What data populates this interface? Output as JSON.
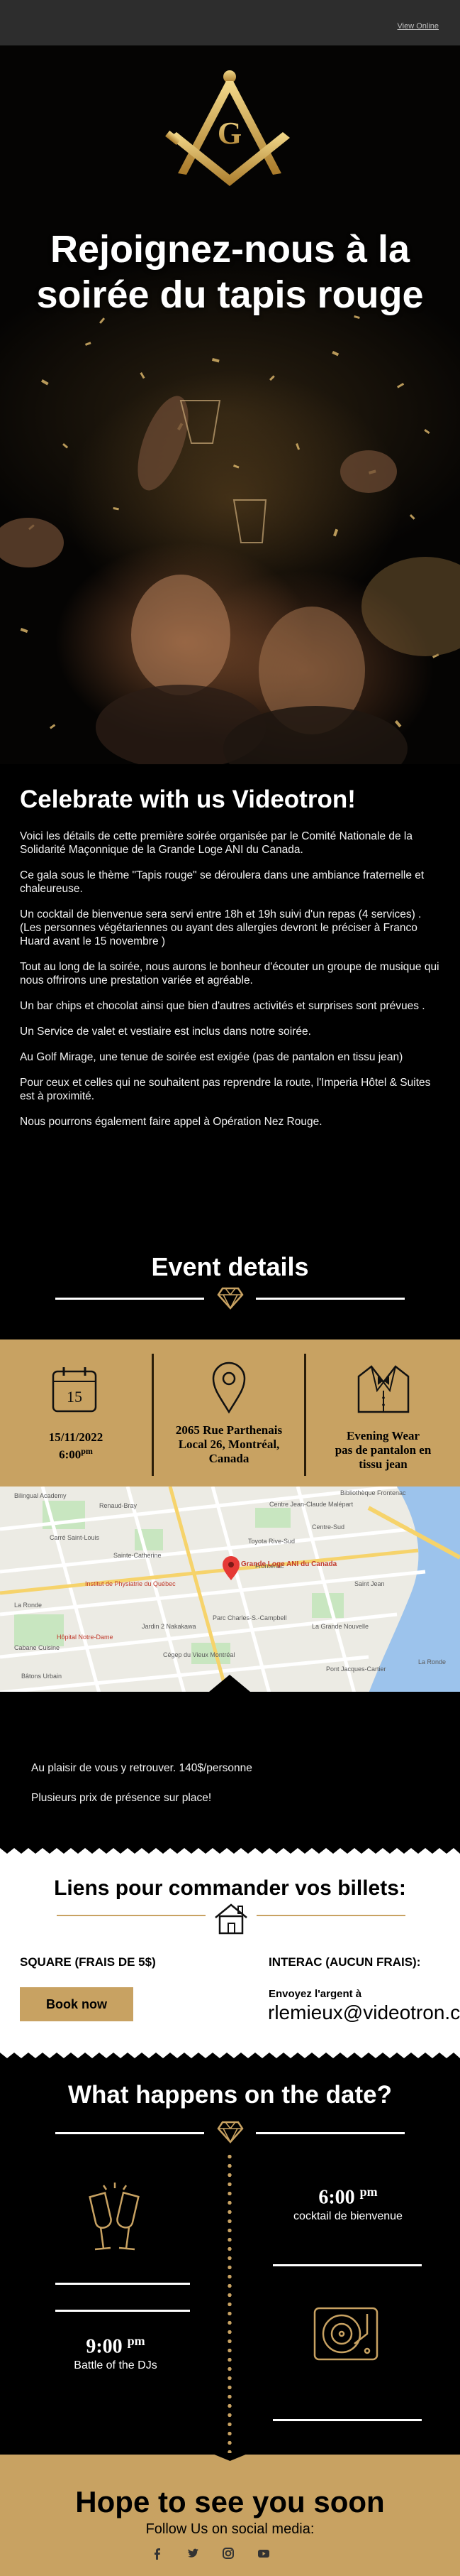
{
  "topbar": {
    "view_online": "View Online"
  },
  "hero": {
    "title": "Rejoignez-nous à la soirée du tapis rouge",
    "logo_letter": "G"
  },
  "intro": {
    "heading": "Celebrate with us Videotron!",
    "paragraphs": [
      "Voici les détails de cette première soirée organisée par le Comité Nationale de la Solidarité Maçonnique de la Grande Loge ANI du Canada.",
      "Ce gala sous le thème \"Tapis rouge\" se déroulera dans une ambiance fraternelle et chaleureuse.",
      "Un cocktail de bienvenue sera servi entre 18h et 19h suivi d'un repas (4 services) . (Les personnes végétariennes ou ayant des allergies devront le préciser à Franco Huard avant le 15 novembre )",
      "Tout au long de la soirée, nous aurons le bonheur d'écouter un groupe de musique qui nous offrirons une prestation variée et agréable.",
      "Un bar chips et chocolat ainsi que bien d'autres activités et surprises sont prévues .",
      "Un Service de valet et vestiaire est inclus dans notre soirée.",
      "Au Golf Mirage, une tenue de soirée est exigée (pas de pantalon en tissu jean)",
      "Pour ceux et celles qui ne souhaitent pas reprendre la route, l'Imperia Hôtel & Suites est à proximité.",
      "Nous pourrons également faire appel à Opération Nez Rouge."
    ]
  },
  "event_details": {
    "title": "Event details",
    "calendar_day": "15",
    "date": "15/11/2022",
    "time_main": "6:00",
    "time_sup": "pm",
    "address": [
      "2065 Rue Parthenais",
      "Local 26, Montréal,",
      "Canada"
    ],
    "dress": [
      "Evening Wear",
      "pas de pantalon en",
      "tissu jean"
    ]
  },
  "map": {
    "labels": [
      "Centre Jean-Claude Malépart",
      "Grande Loge ANI du Canada",
      "Hôpital Notre-Dame",
      "Cabane Cuisine",
      "Centre-Sud",
      "Bibliothèque Frontenac",
      "Institut de Physiatrie du Québec",
      "La Grande Nouvelle",
      "Cégep du Vieux Montréal",
      "Jardin 2 Nakakawa",
      "Saint Jean",
      "Bâtons Urbain",
      "La Ronde",
      "Pont Jacques-Cartier",
      "Carré Saint-Louis",
      "Parc Charles-S.-Campbell",
      "Sainte-Catherine",
      "Renaud-Bray",
      "Toyota Rive-Sud",
      "Bilingual Academy",
      "Frontenac"
    ]
  },
  "extra": {
    "line1": "Au plaisir de vous y retrouver. 140$/personne",
    "line2": "Plusieurs prix de présence sur place!"
  },
  "tickets": {
    "title": "Liens pour commander vos billets:",
    "square_label": "SQUARE (FRAIS DE 5$)",
    "interac_label": "INTERAC (AUCUN FRAIS):",
    "book_button": "Book now",
    "send_to": "Envoyez l'argent à",
    "email": "rlemieux@videotron.ca"
  },
  "schedule": {
    "title": "What happens on the date?",
    "events": [
      {
        "time": "6:00",
        "sup": "pm",
        "label": "cocktail de bienvenue",
        "icon": "champagne-icon"
      },
      {
        "time": "9:00",
        "sup": "pm",
        "label": "Battle of the DJs",
        "icon": "turntable-icon"
      }
    ]
  },
  "footer": {
    "title": "Hope to see you soon",
    "follow": "Follow Us on social media:",
    "socials": [
      "facebook-icon",
      "twitter-icon",
      "instagram-icon",
      "youtube-icon"
    ]
  },
  "colors": {
    "gold": "#c8a262",
    "dark": "#000000",
    "topbar": "#2d2d2d"
  }
}
